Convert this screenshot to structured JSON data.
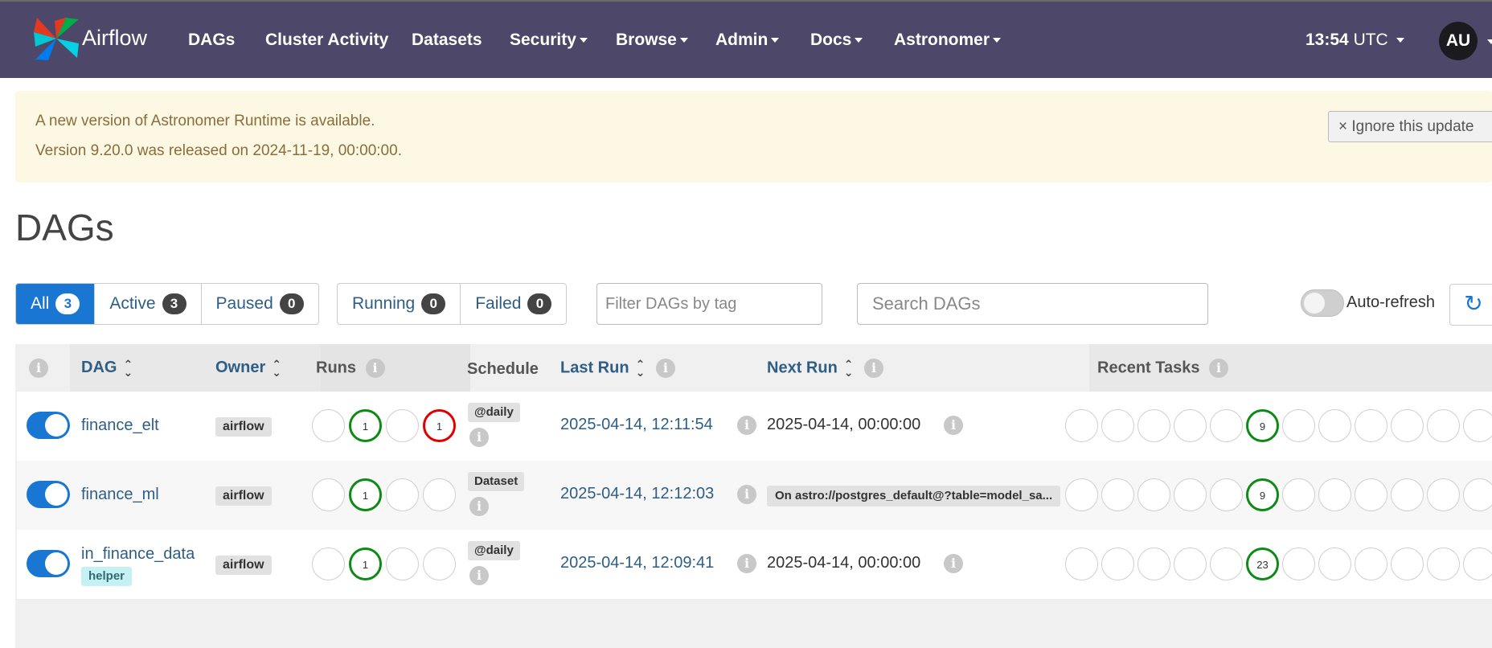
{
  "navbar": {
    "brand": "Airflow",
    "items": [
      {
        "label": "DAGs",
        "dropdown": false
      },
      {
        "label": "Cluster Activity",
        "dropdown": false
      },
      {
        "label": "Datasets",
        "dropdown": false
      },
      {
        "label": "Security",
        "dropdown": true
      },
      {
        "label": "Browse",
        "dropdown": true
      },
      {
        "label": "Admin",
        "dropdown": true
      },
      {
        "label": "Docs",
        "dropdown": true
      },
      {
        "label": "Astronomer",
        "dropdown": true
      }
    ],
    "time": "13:54",
    "timezone": "UTC",
    "user_initials": "AU",
    "bg_color": "#4d4869"
  },
  "alert": {
    "line1": "A new version of Astronomer Runtime is available.",
    "line2": "Version 9.20.0 was released on 2024-11-19, 00:00:00.",
    "ignore_label": "× Ignore this update"
  },
  "page_title": "DAGs",
  "status_filters": [
    {
      "label": "All",
      "count": "3",
      "active": true
    },
    {
      "label": "Active",
      "count": "3",
      "active": false
    },
    {
      "label": "Paused",
      "count": "0",
      "active": false
    }
  ],
  "run_filters": [
    {
      "label": "Running",
      "count": "0"
    },
    {
      "label": "Failed",
      "count": "0"
    }
  ],
  "tag_filter_placeholder": "Filter DAGs by tag",
  "search_placeholder": "Search DAGs",
  "auto_refresh_label": "Auto-refresh",
  "table": {
    "headers": {
      "dag": "DAG",
      "owner": "Owner",
      "runs": "Runs",
      "schedule": "Schedule",
      "last_run": "Last Run",
      "next_run": "Next Run",
      "recent_tasks": "Recent Tasks"
    },
    "rows": [
      {
        "dag_id": "finance_elt",
        "tag": "",
        "owner": "airflow",
        "runs": [
          "",
          "1",
          "",
          "1"
        ],
        "run_states": [
          "none",
          "success",
          "none",
          "failed"
        ],
        "schedule": "@daily",
        "last_run": "2025-04-14, 12:11:54",
        "next_run": "2025-04-14, 00:00:00",
        "next_run_is_dataset": false,
        "recent_tasks_success_count": "9"
      },
      {
        "dag_id": "finance_ml",
        "tag": "",
        "owner": "airflow",
        "runs": [
          "",
          "1",
          "",
          ""
        ],
        "run_states": [
          "none",
          "success",
          "none",
          "none"
        ],
        "schedule": "Dataset",
        "last_run": "2025-04-14, 12:12:03",
        "next_run": "On astro://postgres_default@?table=model_sa...",
        "next_run_is_dataset": true,
        "recent_tasks_success_count": "9"
      },
      {
        "dag_id": "in_finance_data",
        "tag": "helper",
        "owner": "airflow",
        "runs": [
          "",
          "1",
          "",
          ""
        ],
        "run_states": [
          "none",
          "success",
          "none",
          "none"
        ],
        "schedule": "@daily",
        "last_run": "2025-04-14, 12:09:41",
        "next_run": "2025-04-14, 00:00:00",
        "next_run_is_dataset": false,
        "recent_tasks_success_count": "23"
      }
    ]
  },
  "colors": {
    "success": "#0e8a16",
    "failed": "#e00000",
    "primary": "#1976d2",
    "link": "#2e5e86"
  }
}
